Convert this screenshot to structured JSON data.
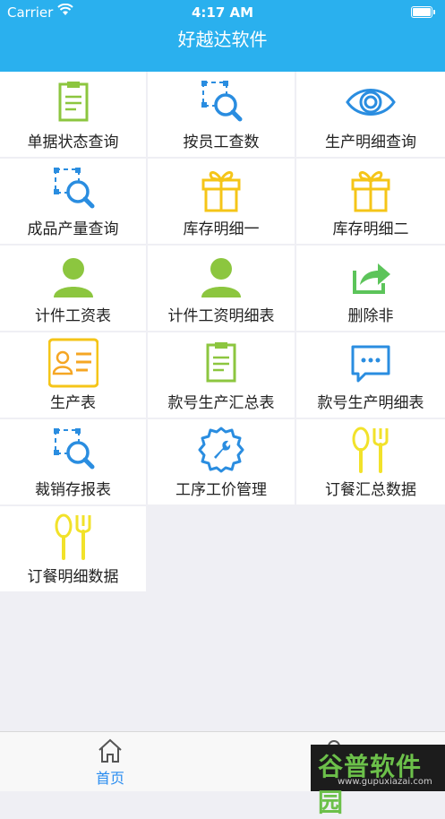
{
  "status_bar": {
    "carrier": "Carrier",
    "time": "4:17 AM"
  },
  "nav": {
    "title": "好越达软件"
  },
  "menu": [
    {
      "label": "单据状态查询",
      "icon": "clipboard-icon"
    },
    {
      "label": "按员工查数",
      "icon": "search-icon"
    },
    {
      "label": "生产明细查询",
      "icon": "eye-icon"
    },
    {
      "label": "成品产量查询",
      "icon": "search-icon"
    },
    {
      "label": "库存明细一",
      "icon": "gift-icon"
    },
    {
      "label": "库存明细二",
      "icon": "gift-icon"
    },
    {
      "label": "计件工资表",
      "icon": "user-icon"
    },
    {
      "label": "计件工资明细表",
      "icon": "user-icon"
    },
    {
      "label": "删除非",
      "icon": "share-icon"
    },
    {
      "label": "生产表",
      "icon": "id-card-icon"
    },
    {
      "label": "款号生产汇总表",
      "icon": "clipboard-icon"
    },
    {
      "label": "款号生产明细表",
      "icon": "chat-icon"
    },
    {
      "label": "裁销存报表",
      "icon": "search-icon"
    },
    {
      "label": "工序工价管理",
      "icon": "wrench-gear-icon"
    },
    {
      "label": "订餐汇总数据",
      "icon": "utensils-icon"
    },
    {
      "label": "订餐明细数据",
      "icon": "utensils-icon"
    }
  ],
  "tabbar": {
    "home": "首页"
  },
  "watermark": {
    "text": "谷普软件园",
    "url": "www.gupuxiazai.com"
  },
  "colors": {
    "nav_blue": "#2ab0ee",
    "clipboard_green": "#8cc63f",
    "search_blue": "#2a8de0",
    "gift_yellow": "#f5c518",
    "user_green": "#8cc63f",
    "share_green": "#5cc45a",
    "utensils_yellow": "#f2e22a",
    "active_tab": "#2a8df0"
  }
}
